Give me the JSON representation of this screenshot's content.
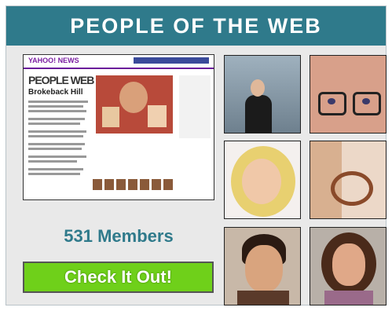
{
  "widget": {
    "title": "PEOPLE OF THE WEB",
    "members_label": "531 Members",
    "cta_label": "Check It Out!",
    "colors": {
      "header_bg": "#2f7a8b",
      "cta_bg": "#6fd01a",
      "members_text": "#2f7a8b"
    }
  },
  "thumbnail": {
    "brand": "YAHOO! NEWS",
    "logo": "PEOPLE WEB",
    "headline": "Brokeback Hill"
  }
}
